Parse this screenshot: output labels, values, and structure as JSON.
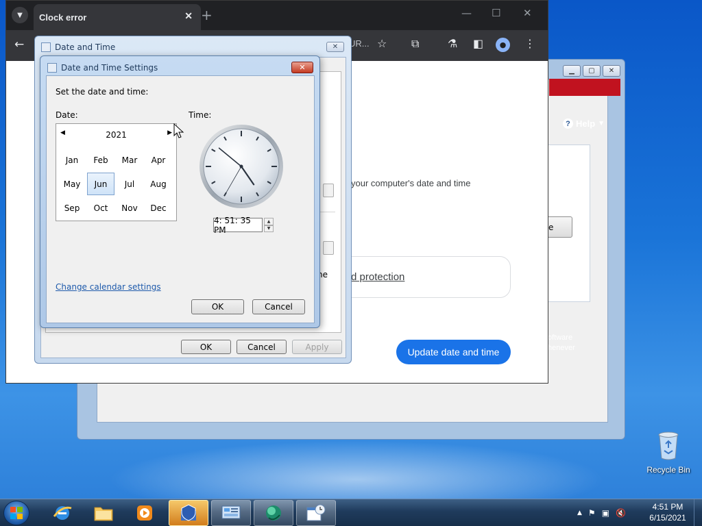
{
  "security_window": {
    "help_label": "Help",
    "button_fragment": "e",
    "text_fragment_1": "oftware",
    "text_fragment_2": "henever"
  },
  "chrome": {
    "tab_title": "Clock error",
    "omnibox_fragment": "UR...",
    "page_info_text": "your computer's date and time",
    "protection_link": "d protection",
    "update_button": "Update date and time"
  },
  "date_time_dialog": {
    "title": "Date and Time",
    "inner_fragment": "he",
    "ok": "OK",
    "cancel": "Cancel",
    "apply": "Apply"
  },
  "settings_dialog": {
    "title": "Date and Time Settings",
    "instruction": "Set the date and time:",
    "date_label": "Date:",
    "time_label": "Time:",
    "calendar": {
      "year": "2021",
      "months": [
        "Jan",
        "Feb",
        "Mar",
        "Apr",
        "May",
        "Jun",
        "Jul",
        "Aug",
        "Sep",
        "Oct",
        "Nov",
        "Dec"
      ],
      "selected_month": "Jun"
    },
    "time_value": "4: 51: 35 PM",
    "change_calendar_link": "Change calendar settings",
    "ok": "OK",
    "cancel": "Cancel"
  },
  "desktop": {
    "recycle_bin_label": "Recycle Bin"
  },
  "taskbar": {
    "time": "4:51 PM",
    "date": "6/15/2021"
  },
  "colors": {
    "chrome_accent": "#1a73e8",
    "security_red": "#c1121f",
    "taskbar": "#1f3b5c"
  }
}
